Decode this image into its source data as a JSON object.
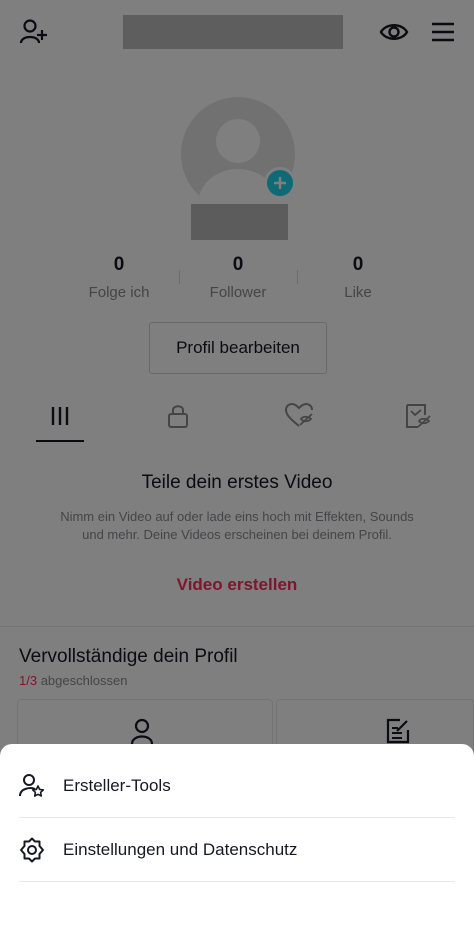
{
  "stats": {
    "following": {
      "value": "0",
      "label": "Folge ich"
    },
    "followers": {
      "value": "0",
      "label": "Follower"
    },
    "likes": {
      "value": "0",
      "label": "Like"
    }
  },
  "profile": {
    "edit_label": "Profil bearbeiten"
  },
  "tabs": [
    {
      "icon": "grid-icon",
      "active": true
    },
    {
      "icon": "lock-icon",
      "active": false
    },
    {
      "icon": "liked-heart-icon",
      "active": false
    },
    {
      "icon": "tagged-icon",
      "active": false
    }
  ],
  "empty_state": {
    "title": "Teile dein erstes Video",
    "description": "Nimm ein Video auf oder lade eins hoch mit Effekten, Sounds und mehr. Deine Videos erscheinen bei deinem Profil.",
    "action": "Video erstellen"
  },
  "completion": {
    "title": "Vervollständige dein Profil",
    "count": "1/3",
    "status": "abgeschlossen"
  },
  "sheet": {
    "items": [
      {
        "label": "Ersteller-Tools",
        "icon": "creator-tools-icon"
      },
      {
        "label": "Einstellungen und Datenschutz",
        "icon": "settings-gear-icon"
      }
    ]
  },
  "colors": {
    "accent": "#fe2c55",
    "brand_teal": "#20d5ec",
    "text": "#161823",
    "muted": "#8a8b91"
  }
}
